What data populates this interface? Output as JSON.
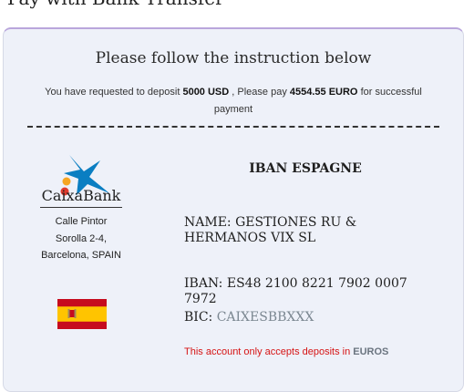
{
  "page": {
    "title": "Pay with Bank Transfer"
  },
  "instructions": {
    "heading": "Please follow the instruction below",
    "notice_prefix": "You have requested to deposit",
    "deposit_amount": "5000 USD",
    "notice_middle": ", Please pay",
    "pay_amount": "4554.55 EURO",
    "notice_suffix": "for successful payment"
  },
  "bank": {
    "logo_icon": "caixabank-star-logo",
    "name": "CaixaBank",
    "address_line1": "Calle Pintor",
    "address_line2": "Sorolla 2-4,",
    "address_line3": "Barcelona, SPAIN",
    "flag_icon": "spain-flag",
    "colors": {
      "logo_blue": "#0a7ec2",
      "logo_orange": "#f6a623",
      "logo_red": "#e03b2e",
      "flag_red": "#c60b1e",
      "flag_yellow": "#ffc400"
    }
  },
  "account": {
    "title": "IBAN ESPAGNE",
    "name_label": "NAME: GESTIONES RU & HERMANOS VIX SL",
    "iban_label": "IBAN: ES48 2100 8221 7902 0007 7972",
    "bic_label": "BIC:",
    "bic_value": "CAIXESBBXXX"
  },
  "warning": {
    "text": "This account only accepts deposits in",
    "currency": "EUROS",
    "color": "#d61414"
  }
}
